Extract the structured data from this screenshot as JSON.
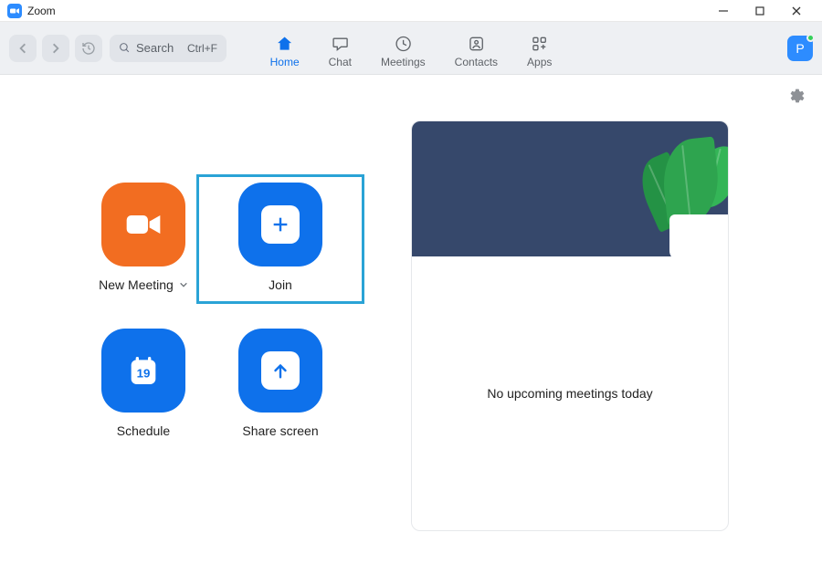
{
  "window": {
    "title": "Zoom"
  },
  "toolbar": {
    "search_placeholder": "Search",
    "search_shortcut": "Ctrl+F",
    "tabs": {
      "home": "Home",
      "chat": "Chat",
      "meetings": "Meetings",
      "contacts": "Contacts",
      "apps": "Apps"
    },
    "avatar_letter": "P"
  },
  "actions": {
    "new_meeting": "New Meeting",
    "join": "Join",
    "schedule": "Schedule",
    "schedule_day": "19",
    "share_screen": "Share screen"
  },
  "panel": {
    "empty_text": "No upcoming meetings today"
  }
}
